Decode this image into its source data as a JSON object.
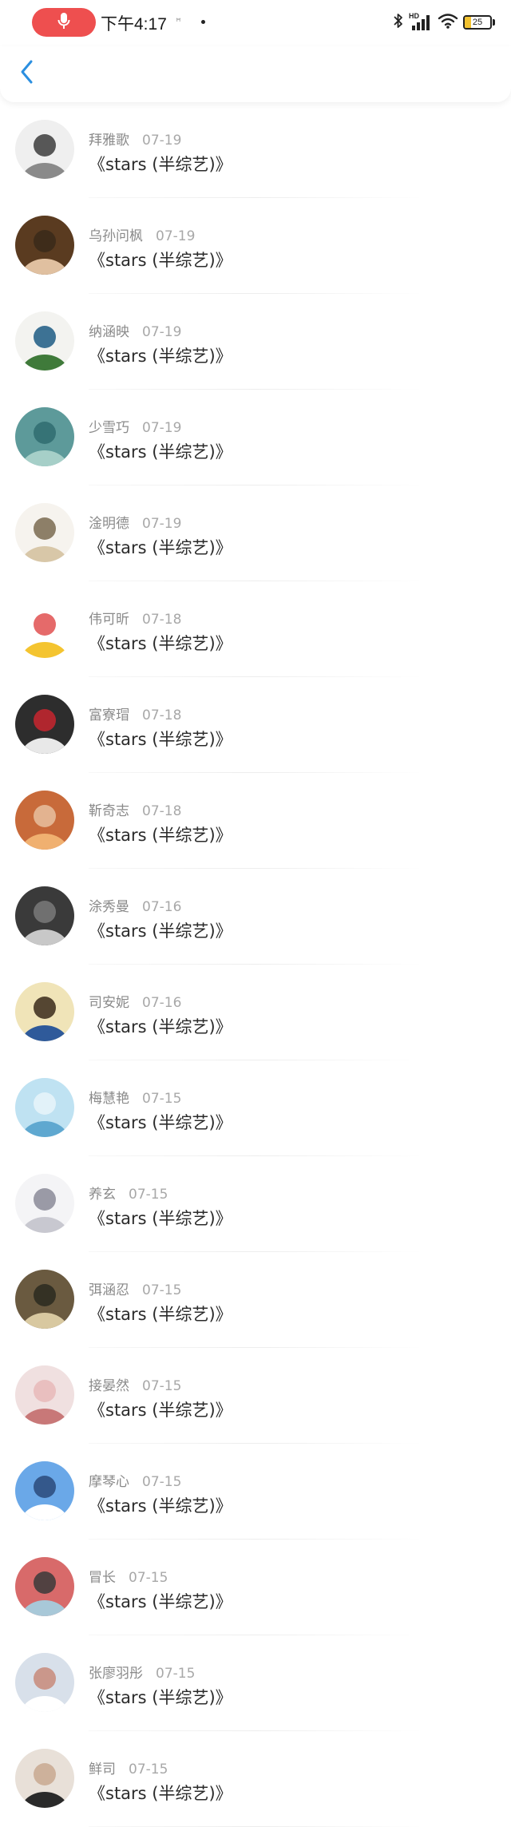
{
  "status_bar": {
    "time": "下午4:17",
    "network": "HD",
    "battery_level": "25",
    "battery_fraction": 0.25,
    "colors": {
      "mic_pill": "#ee4f4f",
      "battery_fill": "#f2c230"
    },
    "icons": [
      "microphone-icon",
      "bluetooth-icon",
      "signal-icon",
      "wifi-icon",
      "battery-icon"
    ]
  },
  "header": {
    "back_icon": "chevron-left-icon",
    "accent_color": "#2b8fe0"
  },
  "comments": [
    {
      "name": "拜雅歌",
      "date": "07-19",
      "text": "《stars (半综艺)》",
      "avatar_colors": [
        "#efefef",
        "#8a8a8a",
        "#3c3c3c"
      ]
    },
    {
      "name": "乌孙问枫",
      "date": "07-19",
      "text": "《stars (半综艺)》",
      "avatar_colors": [
        "#5a3b20",
        "#e0c0a0",
        "#3a2a1a"
      ]
    },
    {
      "name": "纳涵映",
      "date": "07-19",
      "text": "《stars (半综艺)》",
      "avatar_colors": [
        "#f3f3f0",
        "#3f7a3a",
        "#1c5a84"
      ]
    },
    {
      "name": "少雪巧",
      "date": "07-19",
      "text": "《stars (半综艺)》",
      "avatar_colors": [
        "#5d9a9a",
        "#a6cfc8",
        "#2f6c70"
      ]
    },
    {
      "name": "淦明德",
      "date": "07-19",
      "text": "《stars (半综艺)》",
      "avatar_colors": [
        "#f6f3ee",
        "#d8c7a8",
        "#7a6a50"
      ]
    },
    {
      "name": "伟可昕",
      "date": "07-18",
      "text": "《stars (半综艺)》",
      "avatar_colors": [
        "#ffffff",
        "#f4c430",
        "#e05050"
      ]
    },
    {
      "name": "富寮瑁",
      "date": "07-18",
      "text": "《stars (半综艺)》",
      "avatar_colors": [
        "#2d2d2d",
        "#e8e8e8",
        "#c8262f"
      ]
    },
    {
      "name": "靳奇志",
      "date": "07-18",
      "text": "《stars (半综艺)》",
      "avatar_colors": [
        "#c86a3a",
        "#f0b070",
        "#e8c0a0"
      ]
    },
    {
      "name": "涂秀曼",
      "date": "07-16",
      "text": "《stars (半综艺)》",
      "avatar_colors": [
        "#3a3a3a",
        "#c8c8c8",
        "#7a7a7a"
      ]
    },
    {
      "name": "司安妮",
      "date": "07-16",
      "text": "《stars (半综艺)》",
      "avatar_colors": [
        "#f0e4b8",
        "#2f5a9a",
        "#3a2a1a"
      ]
    },
    {
      "name": "梅慧艳",
      "date": "07-15",
      "text": "《stars (半综艺)》",
      "avatar_colors": [
        "#bfe2f2",
        "#5fa8d0",
        "#e8f4fa"
      ]
    },
    {
      "name": "养玄",
      "date": "07-15",
      "text": "《stars (半综艺)》",
      "avatar_colors": [
        "#f4f4f6",
        "#c8c8d0",
        "#8a8a98"
      ]
    },
    {
      "name": "弭涵忍",
      "date": "07-15",
      "text": "《stars (半综艺)》",
      "avatar_colors": [
        "#6a5a40",
        "#d8c8a0",
        "#2a2a20"
      ]
    },
    {
      "name": "接晏然",
      "date": "07-15",
      "text": "《stars (半综艺)》",
      "avatar_colors": [
        "#f0e0e0",
        "#c87878",
        "#e8b8b8"
      ]
    },
    {
      "name": "摩琴心",
      "date": "07-15",
      "text": "《stars (半综艺)》",
      "avatar_colors": [
        "#6aa8e8",
        "#ffffff",
        "#2a4a7a"
      ]
    },
    {
      "name": "冒长",
      "date": "07-15",
      "text": "《stars (半综艺)》",
      "avatar_colors": [
        "#d86a6a",
        "#a8c8d8",
        "#3a3a3a"
      ]
    },
    {
      "name": "张廖羽彤",
      "date": "07-15",
      "text": "《stars (半综艺)》",
      "avatar_colors": [
        "#d8e0ea",
        "#ffffff",
        "#c88a7a"
      ]
    },
    {
      "name": "鲜司",
      "date": "07-15",
      "text": "《stars (半综艺)》",
      "avatar_colors": [
        "#e8e0d8",
        "#2a2a2a",
        "#c8a890"
      ]
    }
  ]
}
